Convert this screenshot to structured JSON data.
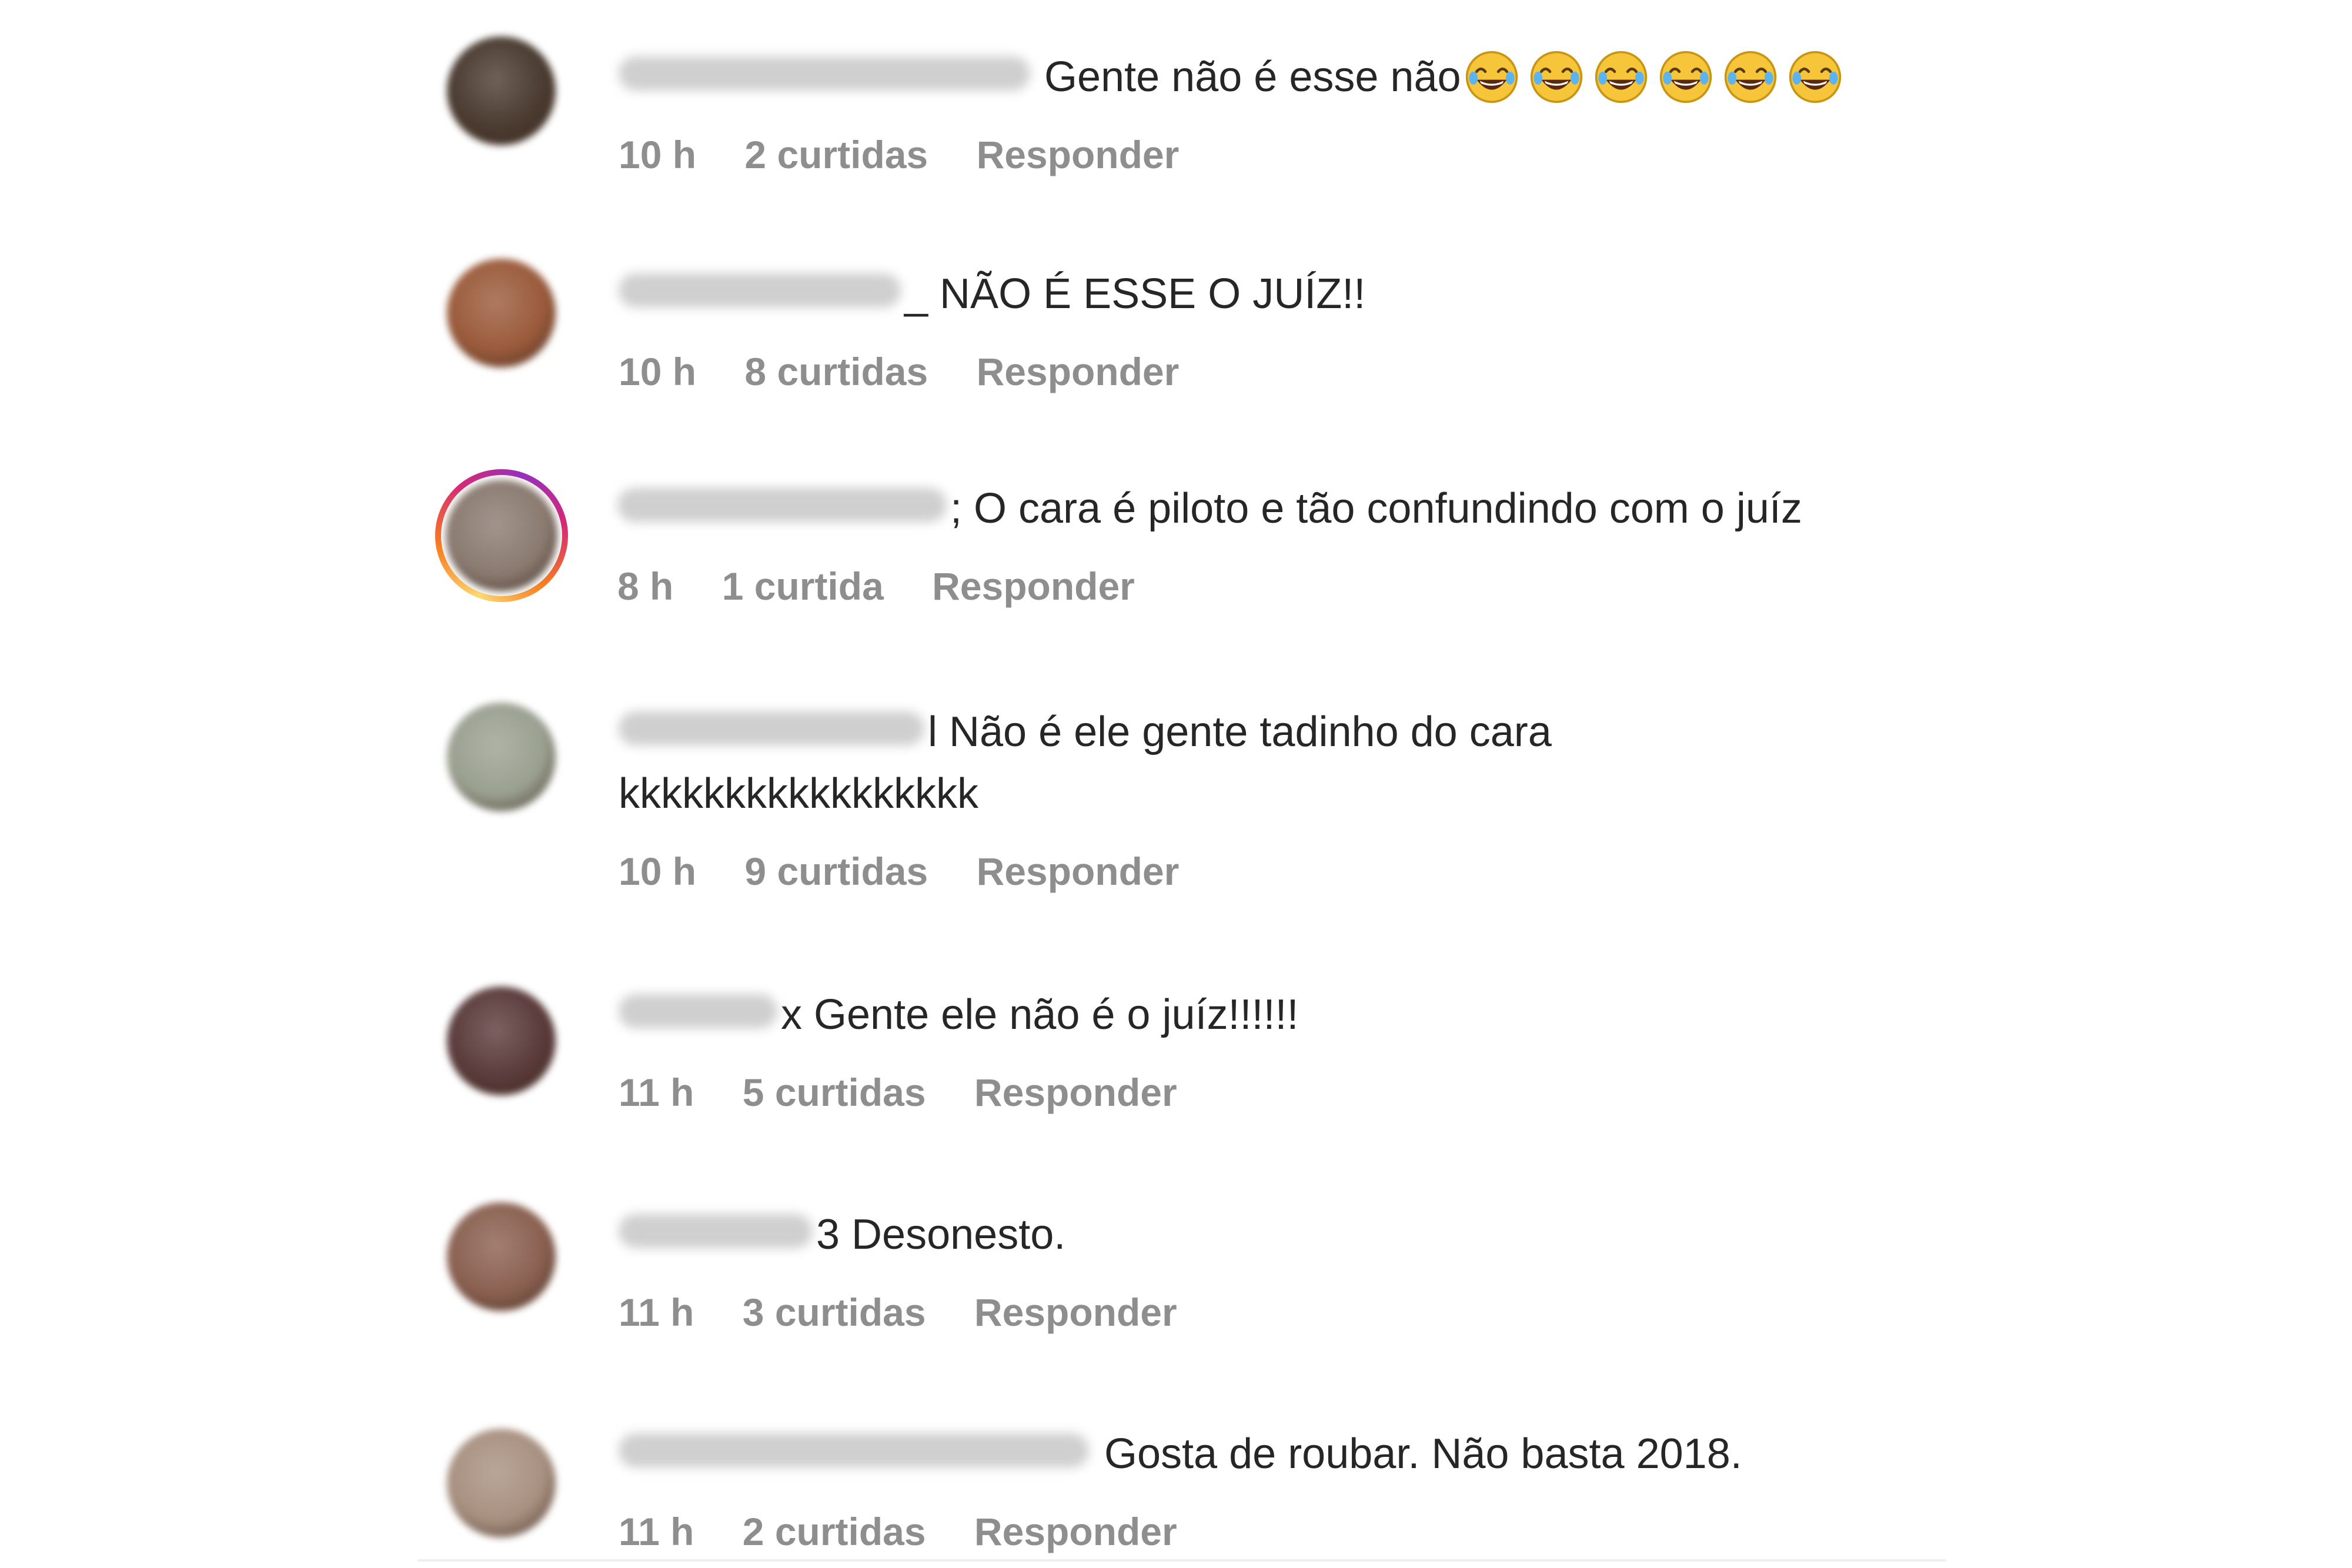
{
  "comments": [
    {
      "text": "Gente não é esse não",
      "emoji_count": 6,
      "emoji_icon": "face-with-tears-of-joy-icon",
      "time": "10 h",
      "likes": "2 curtidas",
      "reply_label": "Responder",
      "avatar_color": "#4a3a30"
    },
    {
      "text": "_ NÃO É ESSE O JUÍZ!!",
      "time": "10 h",
      "likes": "8 curtidas",
      "reply_label": "Responder",
      "avatar_color": "#9a5a3a"
    },
    {
      "text": "; O cara é piloto e tão confundindo com o juíz",
      "time": "8 h",
      "likes": "1 curtida",
      "reply_label": "Responder",
      "avatar_color": "#8a7a70",
      "story_ring": true
    },
    {
      "text": "l Não é ele gente tadinho do cara",
      "text_line2": "kkkkkkkkkkkkkkkkk",
      "time": "10 h",
      "likes": "9 curtidas",
      "reply_label": "Responder",
      "avatar_color": "#9aa090"
    },
    {
      "text": "x Gente ele não é o juíz!!!!!!",
      "time": "11 h",
      "likes": "5 curtidas",
      "reply_label": "Responder",
      "avatar_color": "#5a3a3a"
    },
    {
      "text": "3 Desonesto.",
      "time": "11 h",
      "likes": "3 curtidas",
      "reply_label": "Responder",
      "avatar_color": "#8a6050"
    },
    {
      "text": "Gosta de roubar. Não basta 2018.",
      "time": "11 h",
      "likes": "2 curtidas",
      "reply_label": "Responder",
      "avatar_color": "#a89080"
    }
  ]
}
